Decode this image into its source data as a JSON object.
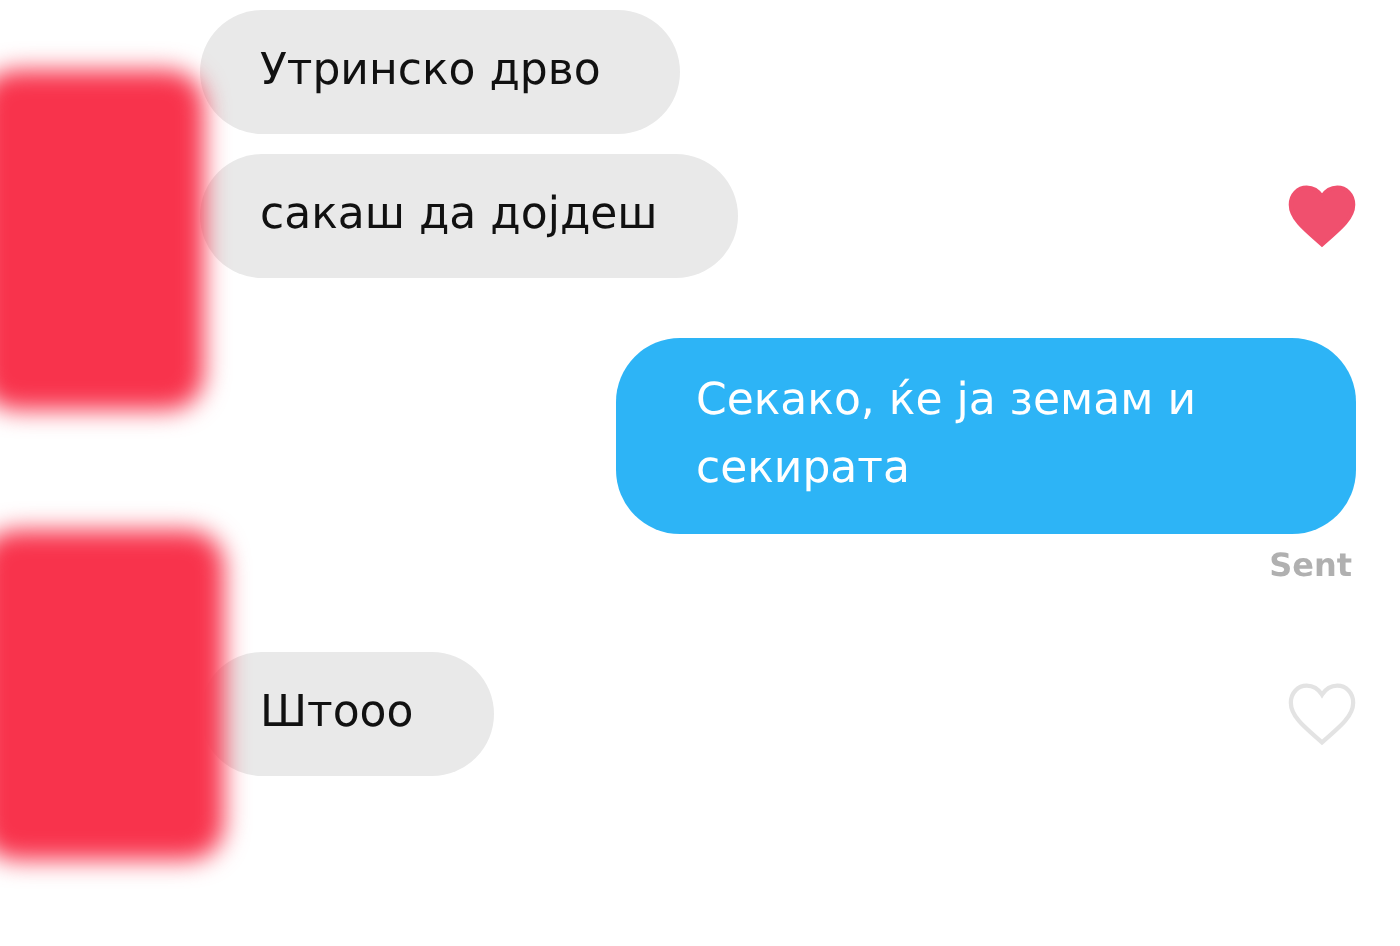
{
  "messages": [
    {
      "kind": "received",
      "text": "Утринско дрво"
    },
    {
      "kind": "received",
      "text": "сакаш да дојдеш",
      "liked": true
    },
    {
      "kind": "sent",
      "text": "Секако, ќе ја земам и секирата",
      "status": "Sent"
    },
    {
      "kind": "received",
      "text": "Штооо",
      "liked": false
    }
  ]
}
